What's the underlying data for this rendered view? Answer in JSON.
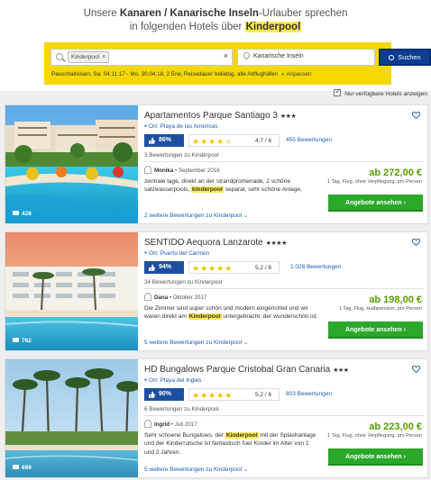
{
  "header": {
    "line1_pre": "Unsere ",
    "line1_bold": "Kanaren / Kanarische Inseln",
    "line1_post": "-Urlauber sprechen",
    "line2_pre": "in folgenden Hotels über ",
    "line2_highlight": "Kinderpool"
  },
  "search": {
    "chip_label": "Kinderpool",
    "chip_remove": "×",
    "clear": "×",
    "destination": "Kanarische Inseln",
    "button_label": "Suchen",
    "summary": "Pauschalreisen, Sa. 04.11.17 - Mo. 30.04.18, 2 Erw, Reisedauer beliebig, alle Abflughäfen",
    "adjust_label": "Anpassen",
    "accent": "#f5d800",
    "button_color": "#0b3d91"
  },
  "filter": {
    "only_available_label": "Nur verfügbare Hotels anzeigen",
    "checked": true
  },
  "hotels": [
    {
      "name": "Apartamentos Parque Santiago 3",
      "stars": "★★★",
      "location": "Ort: Playa de las Americas",
      "recommend": "86%",
      "suns_full": "★★★★",
      "suns_half": "★",
      "rating": "4,7 / 6",
      "reviews": "455 Bewertungen",
      "reviews_kp": "3 Bewertungen zu Kinderpool",
      "reviewer": "Monika",
      "review_date": " • September 2016",
      "review_pre": "zentrale lage, direkt an der strandpromenade, 2 schöne salzwasserpools, ",
      "review_hl": "kinderpool",
      "review_post": " separat, sehr schöne Anlage,",
      "more": "2 weitere Bewertungen zu Kinderpool",
      "price": "ab 272,00 €",
      "price_sub": "1 Tag, Flug, ohne Verpflegung, pro Person",
      "button": "Angebote ansehen ›",
      "photos": "428"
    },
    {
      "name": "SENTIDO Aequora Lanzarote",
      "stars": "★★★★",
      "location": "Ort: Puerto del Carmen",
      "recommend": "94%",
      "suns_full": "★★★★★",
      "suns_half": "",
      "rating": "5,2 / 6",
      "reviews": "1.028 Bewertungen",
      "reviews_kp": "34 Bewertungen zu Kinderpool",
      "reviewer": "Dana",
      "review_date": " • Oktober 2017",
      "review_pre": "Die Zimmer sind super schön und modern eingerichtet und wir waren direkt am ",
      "review_hl": "Kinderpool",
      "review_post": " untergebracht, der wunderschön ist.",
      "more": "5 weitere Bewertungen zu Kinderpool",
      "price": "ab 198,00 €",
      "price_sub": "1 Tag, Flug, Halbpension, pro Person",
      "button": "Angebote ansehen ›",
      "photos": "762"
    },
    {
      "name": "HD Bungalows Parque Cristobal Gran Canaria",
      "stars": "★★★",
      "location": "Ort: Playa del Ingles",
      "recommend": "90%",
      "suns_full": "★★★★★",
      "suns_half": "",
      "rating": "5,2 / 6",
      "reviews": "803 Bewertungen",
      "reviews_kp": "6 Bewertungen zu Kinderpool",
      "reviewer": "Ingrid",
      "review_date": " • Juli 2017",
      "review_pre": "Sehr schoene Bungalows, der ",
      "review_hl": "Kinderpool",
      "review_post": " mit der Splashanlage und der Kinderrutsche ist fantastisch fuer Kinder im Alter von 1 und 2 Jahren.",
      "more": "5 weitere Bewertungen zu Kinderpool",
      "price": "ab 223,00 €",
      "price_sub": "1 Tag, Flug, ohne Verpflegung, pro Person",
      "button": "Angebote ansehen ›",
      "photos": "699"
    }
  ]
}
